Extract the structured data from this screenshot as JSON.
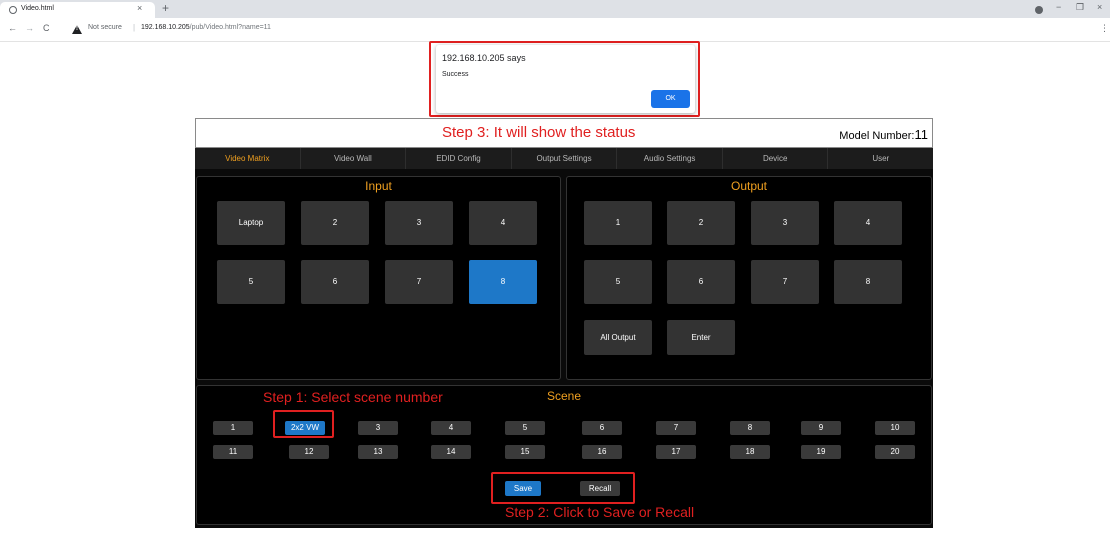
{
  "browser": {
    "tab_title": "Video.html",
    "tab_close": "×",
    "new_tab": "+",
    "not_secure": "Not secure",
    "url_host": "192.168.10.205",
    "url_path": "/pub/Video.html?name=11",
    "back": "←",
    "forward": "→",
    "reload": "C",
    "minimize": "−",
    "restore": "❐",
    "close": "×",
    "menu": "⋮"
  },
  "alert": {
    "title": "192.168.10.205 says",
    "message": "Success",
    "ok_label": "OK"
  },
  "annotations": {
    "step1": "Step 1: Select scene number",
    "step2": "Step 2: Click to Save or Recall",
    "step3": "Step 3: It will show the status",
    "color": "#e02020"
  },
  "header": {
    "model_label": "Model Number:",
    "model_number": "11"
  },
  "nav": {
    "items": [
      "Video Matrix",
      "Video Wall",
      "EDID Config",
      "Output Settings",
      "Audio Settings",
      "Device",
      "User"
    ],
    "active": "Video Matrix",
    "active_color": "#f0a020"
  },
  "input": {
    "title": "Input",
    "buttons": [
      "Laptop",
      "2",
      "3",
      "4",
      "5",
      "6",
      "7",
      "8"
    ],
    "selected": "8"
  },
  "output": {
    "title": "Output",
    "buttons": [
      "1",
      "2",
      "3",
      "4",
      "5",
      "6",
      "7",
      "8"
    ],
    "all_output": "All Output",
    "enter": "Enter"
  },
  "scene": {
    "title": "Scene",
    "buttons": [
      "1",
      "2x2 VW",
      "3",
      "4",
      "5",
      "6",
      "7",
      "8",
      "9",
      "10",
      "11",
      "12",
      "13",
      "14",
      "15",
      "16",
      "17",
      "18",
      "19",
      "20"
    ],
    "selected": "2x2 VW",
    "save": "Save",
    "recall": "Recall"
  },
  "colors": {
    "accent": "#f0a020",
    "selected": "#1e78c8",
    "button": "#333333"
  }
}
